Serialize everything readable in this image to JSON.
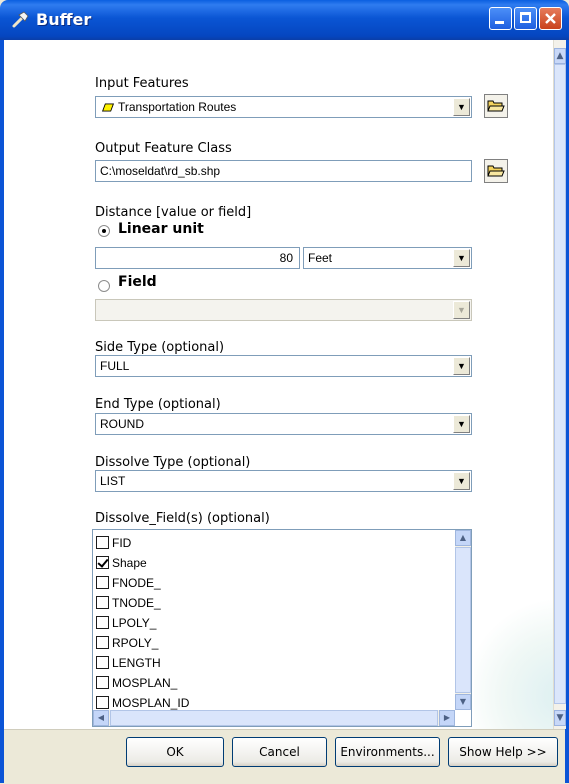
{
  "window": {
    "title": "Buffer"
  },
  "input_features": {
    "label": "Input Features",
    "value": "Transportation Routes"
  },
  "output_feature_class": {
    "label": "Output Feature Class",
    "value": "C:\\moseldat\\rd_sb.shp"
  },
  "distance": {
    "label": "Distance [value or field]",
    "linear_unit_label": "Linear unit",
    "linear_unit_selected": true,
    "value": "80",
    "unit": "Feet",
    "field_label": "Field",
    "field_value": ""
  },
  "side_type": {
    "label": "Side Type (optional)",
    "value": "FULL"
  },
  "end_type": {
    "label": "End Type (optional)",
    "value": "ROUND"
  },
  "dissolve_type": {
    "label": "Dissolve Type (optional)",
    "value": "LIST"
  },
  "dissolve_fields": {
    "label": "Dissolve_Field(s) (optional)",
    "items": [
      {
        "name": "FID",
        "checked": false
      },
      {
        "name": "Shape",
        "checked": true
      },
      {
        "name": "FNODE_",
        "checked": false
      },
      {
        "name": "TNODE_",
        "checked": false
      },
      {
        "name": "LPOLY_",
        "checked": false
      },
      {
        "name": "RPOLY_",
        "checked": false
      },
      {
        "name": "LENGTH",
        "checked": false
      },
      {
        "name": "MOSPLAN_",
        "checked": false
      },
      {
        "name": "MOSPLAN_ID",
        "checked": false
      }
    ]
  },
  "buttons": {
    "ok": "OK",
    "cancel": "Cancel",
    "environments": "Environments...",
    "show_help": "Show Help >>"
  },
  "icons": {
    "title": "hammer-icon",
    "feature": "polyline-feature-icon",
    "browse": "open-folder-icon"
  },
  "colors": {
    "titlebar": "#0a55d4",
    "dialog_bg": "#ece9d8",
    "field_border": "#7f9db9"
  }
}
